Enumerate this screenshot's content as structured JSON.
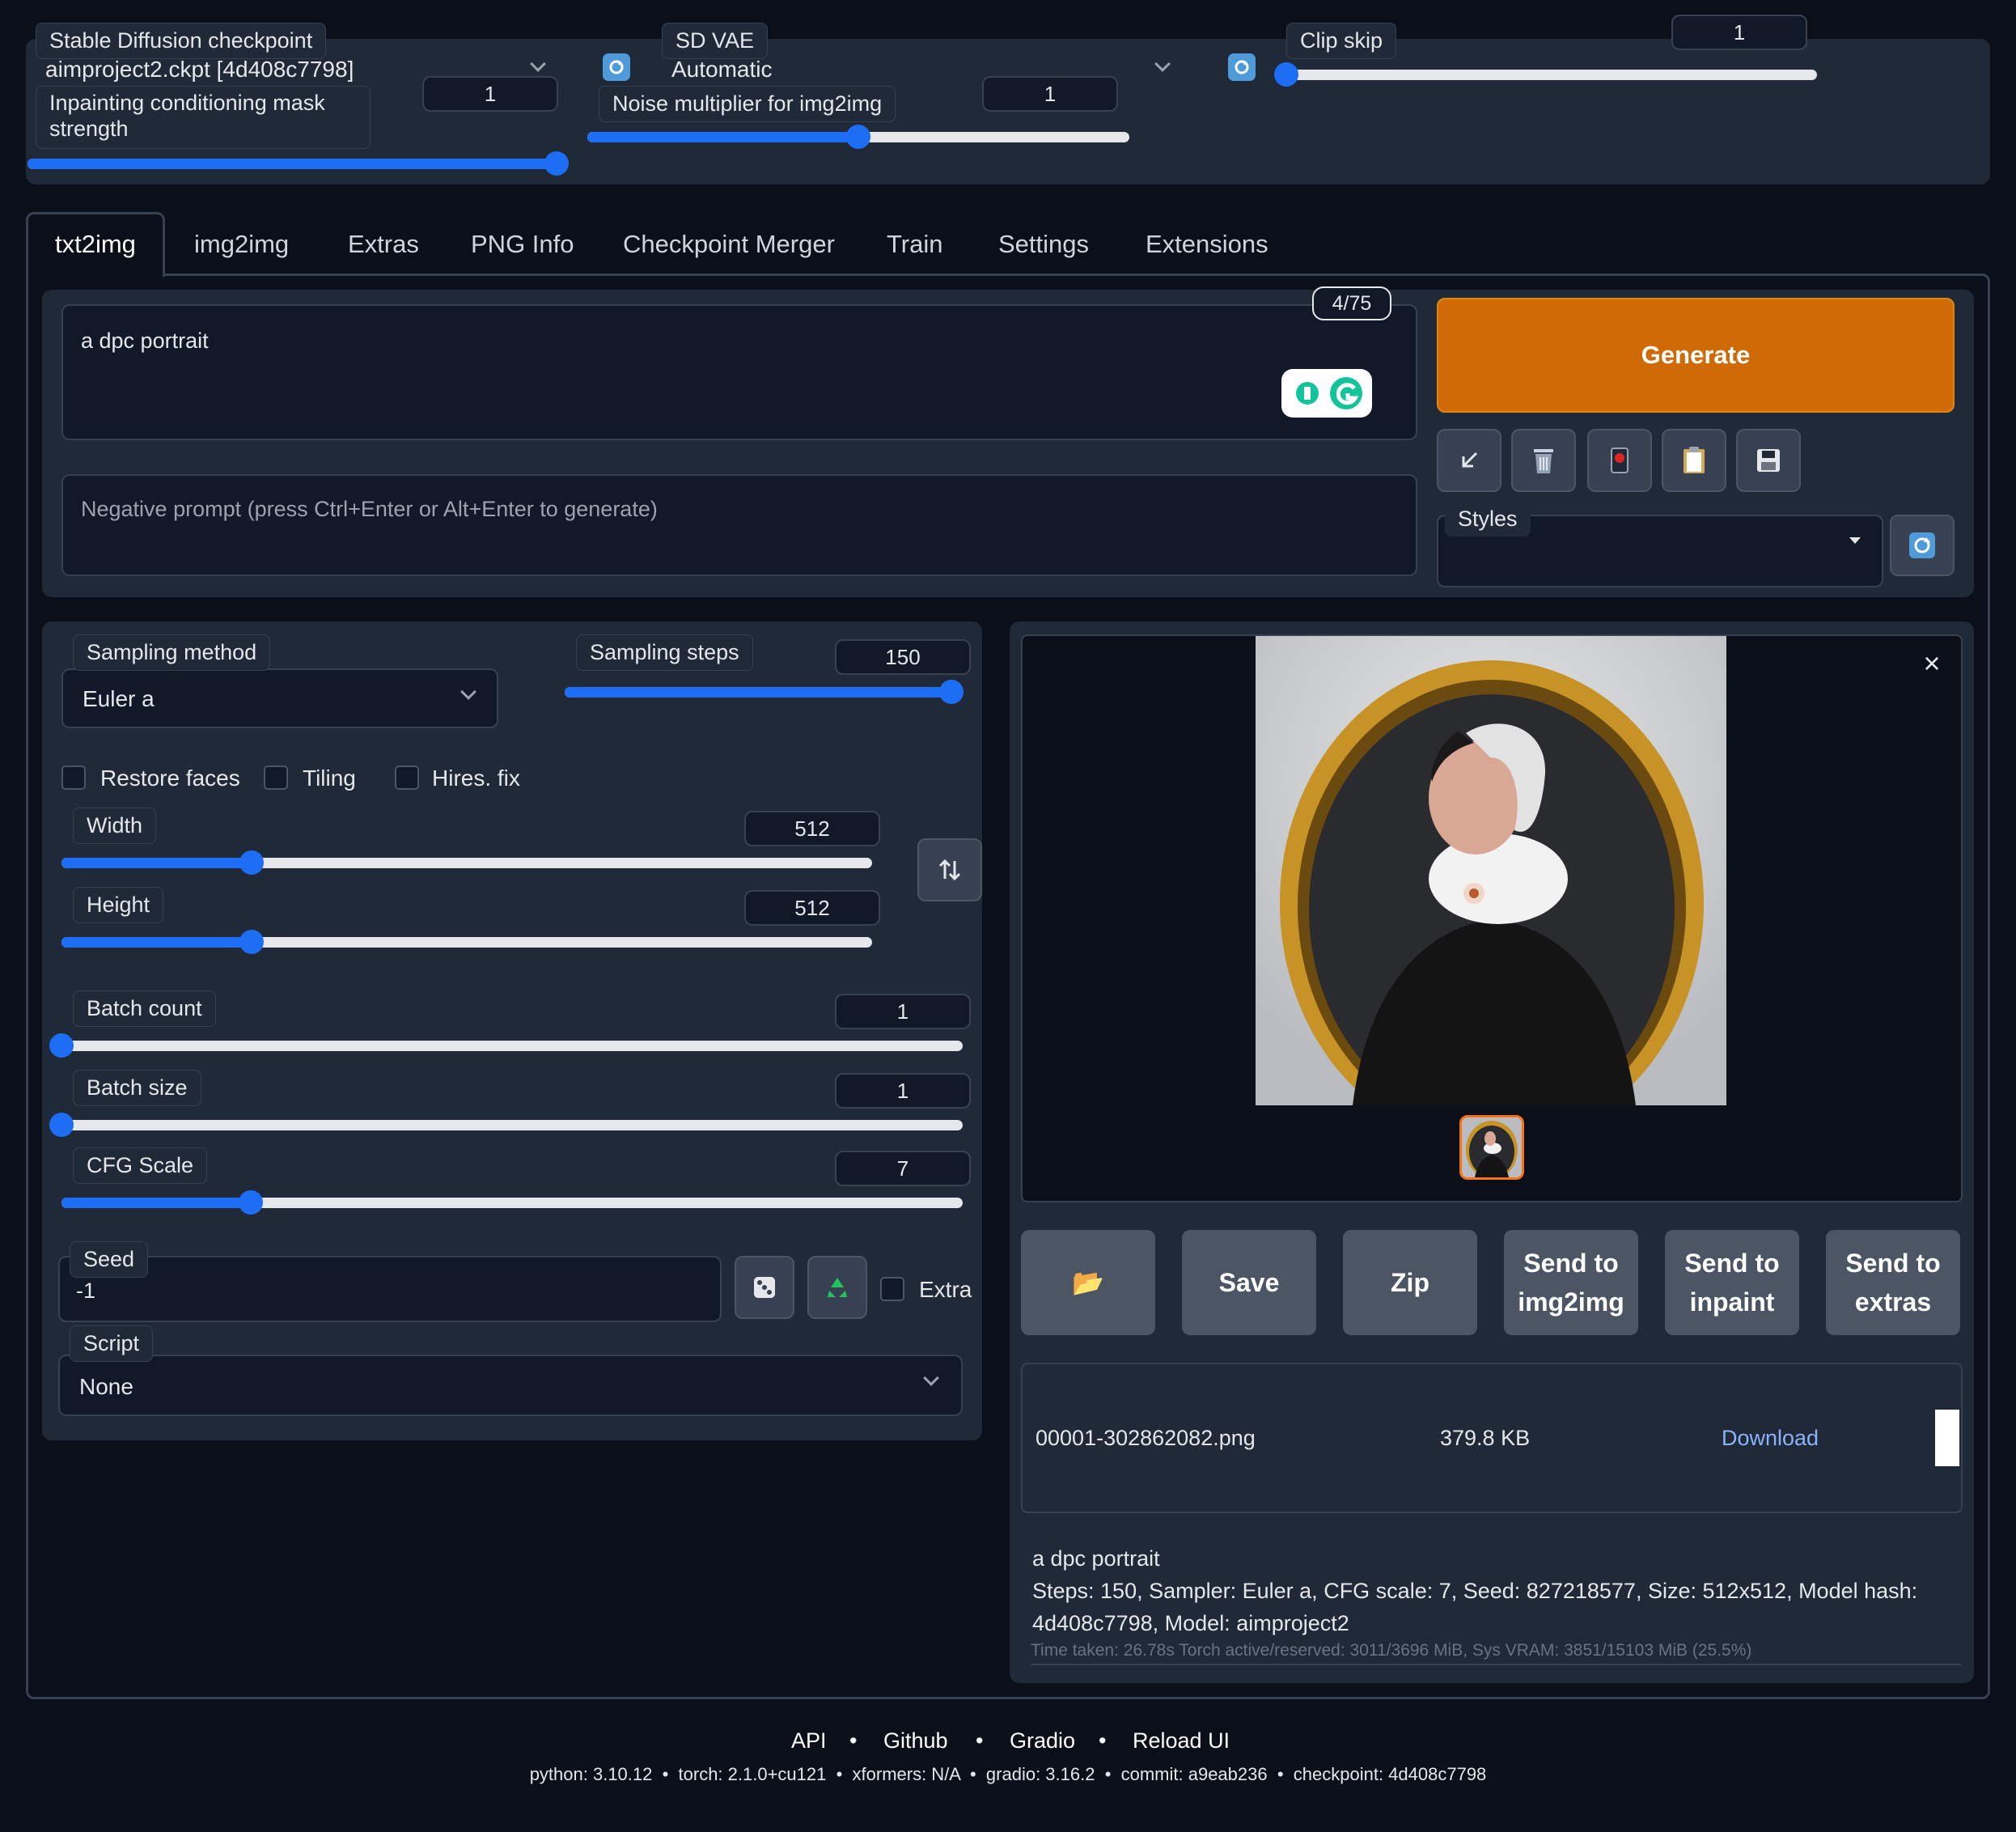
{
  "top": {
    "checkpoint_label": "Stable Diffusion checkpoint",
    "checkpoint_value": "aimproject2.ckpt [4d408c7798]",
    "vae_label": "SD VAE",
    "vae_value": "Automatic",
    "clip_label": "Clip skip",
    "clip_value": "1",
    "clip_level": 0,
    "inpaint_label": "Inpainting conditioning mask strength",
    "inpaint_value": "1",
    "inpaint_level": 1,
    "noise_label": "Noise multiplier for img2img",
    "noise_value": "1",
    "noise_level": 0.5
  },
  "tabs": [
    "txt2img",
    "img2img",
    "Extras",
    "PNG Info",
    "Checkpoint Merger",
    "Train",
    "Settings",
    "Extensions"
  ],
  "prompt": {
    "text": "a dpc portrait",
    "counter": "4/75",
    "negative_placeholder": "Negative prompt (press Ctrl+Enter or Alt+Enter to generate)"
  },
  "generate_label": "Generate",
  "tool_icons": [
    "arrow-icon",
    "trash-icon",
    "red-card-icon",
    "clipboard-icon",
    "save-icon"
  ],
  "styles_label": "Styles",
  "sampling": {
    "method_label": "Sampling method",
    "method_value": "Euler a",
    "steps_label": "Sampling steps",
    "steps_value": "150",
    "steps_level": 1
  },
  "checks": {
    "restore": "Restore faces",
    "tiling": "Tiling",
    "hires": "Hires. fix"
  },
  "sliders": {
    "width_label": "Width",
    "width_value": "512",
    "width_level": 0.235,
    "height_label": "Height",
    "height_value": "512",
    "height_level": 0.235,
    "batch_count_label": "Batch count",
    "batch_count_value": "1",
    "batch_count_level": 0,
    "batch_size_label": "Batch size",
    "batch_size_value": "1",
    "batch_size_level": 0,
    "cfg_label": "CFG Scale",
    "cfg_value": "7",
    "cfg_level": 0.21
  },
  "seed": {
    "label": "Seed",
    "value": "-1",
    "extra_label": "Extra"
  },
  "script": {
    "label": "Script",
    "value": "None"
  },
  "output": {
    "close_glyph": "×",
    "folder_glyph": "📂",
    "buttons": [
      "Save",
      "Zip",
      "Send to img2img",
      "Send to inpaint",
      "Send to extras"
    ],
    "file_name": "00001-302862082.png",
    "file_size": "379.8 KB",
    "download": "Download",
    "info_prompt": "a dpc portrait",
    "info_params": "Steps: 150, Sampler: Euler a, CFG scale: 7, Seed: 827218577, Size: 512x512, Model hash: 4d408c7798, Model: aimproject2",
    "time_info": "Time taken: 26.78s  Torch active/reserved: 3011/3696 MiB, Sys VRAM: 3851/15103 MiB (25.5%)"
  },
  "footer": {
    "links": [
      "API",
      "Github",
      "Gradio",
      "Reload UI"
    ],
    "sep": "•",
    "versions": "python: 3.10.12  •  torch: 2.1.0+cu121  •  xformers: N/A  •  gradio: 3.16.2  •  commit: a9eab236  •  checkpoint: 4d408c7798"
  },
  "colors": {
    "accent": "#1d6ef5",
    "generate": "#cf6a06",
    "bg": "#0b0f19",
    "panel": "#1f2937"
  }
}
